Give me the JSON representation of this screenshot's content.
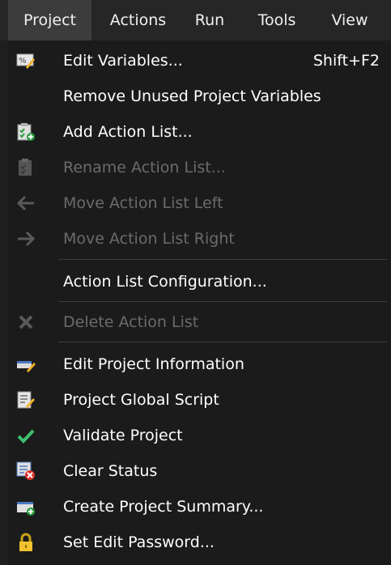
{
  "menubar": {
    "items": [
      {
        "label": "Project",
        "active": true
      },
      {
        "label": "Actions"
      },
      {
        "label": "Run"
      },
      {
        "label": "Tools"
      },
      {
        "label": "View"
      }
    ]
  },
  "menu": {
    "items": [
      {
        "label": "Edit Variables...",
        "shortcut": "Shift+F2",
        "icon": "variables-icon",
        "enabled": true
      },
      {
        "label": "Remove Unused Project Variables",
        "icon": null,
        "enabled": true
      },
      {
        "label": "Add Action List...",
        "icon": "add-list-icon",
        "enabled": true
      },
      {
        "label": "Rename Action List...",
        "icon": "rename-list-icon",
        "enabled": false
      },
      {
        "label": "Move Action List Left",
        "icon": "arrow-left-icon",
        "enabled": false
      },
      {
        "label": "Move Action List Right",
        "icon": "arrow-right-icon",
        "enabled": false
      },
      {
        "label": "Action List Configuration...",
        "icon": null,
        "enabled": true
      },
      {
        "label": "Delete Action List",
        "icon": "delete-icon",
        "enabled": false
      },
      {
        "label": "Edit Project Information",
        "icon": "edit-info-icon",
        "enabled": true
      },
      {
        "label": "Project Global Script",
        "icon": "script-icon",
        "enabled": true
      },
      {
        "label": "Validate Project",
        "icon": "checkmark-icon",
        "enabled": true
      },
      {
        "label": "Clear Status",
        "icon": "clear-status-icon",
        "enabled": true
      },
      {
        "label": "Create Project Summary...",
        "icon": "summary-icon",
        "enabled": true
      },
      {
        "label": "Set Edit Password...",
        "icon": "lock-icon",
        "enabled": true
      }
    ]
  },
  "colors": {
    "background": "#1b1b1b",
    "menubar": "#262626",
    "active_menu": "#3c3c3c",
    "disabled_text": "#6b6b6b",
    "separator": "#3d3d3d",
    "checkmark": "#3fbf6f"
  }
}
